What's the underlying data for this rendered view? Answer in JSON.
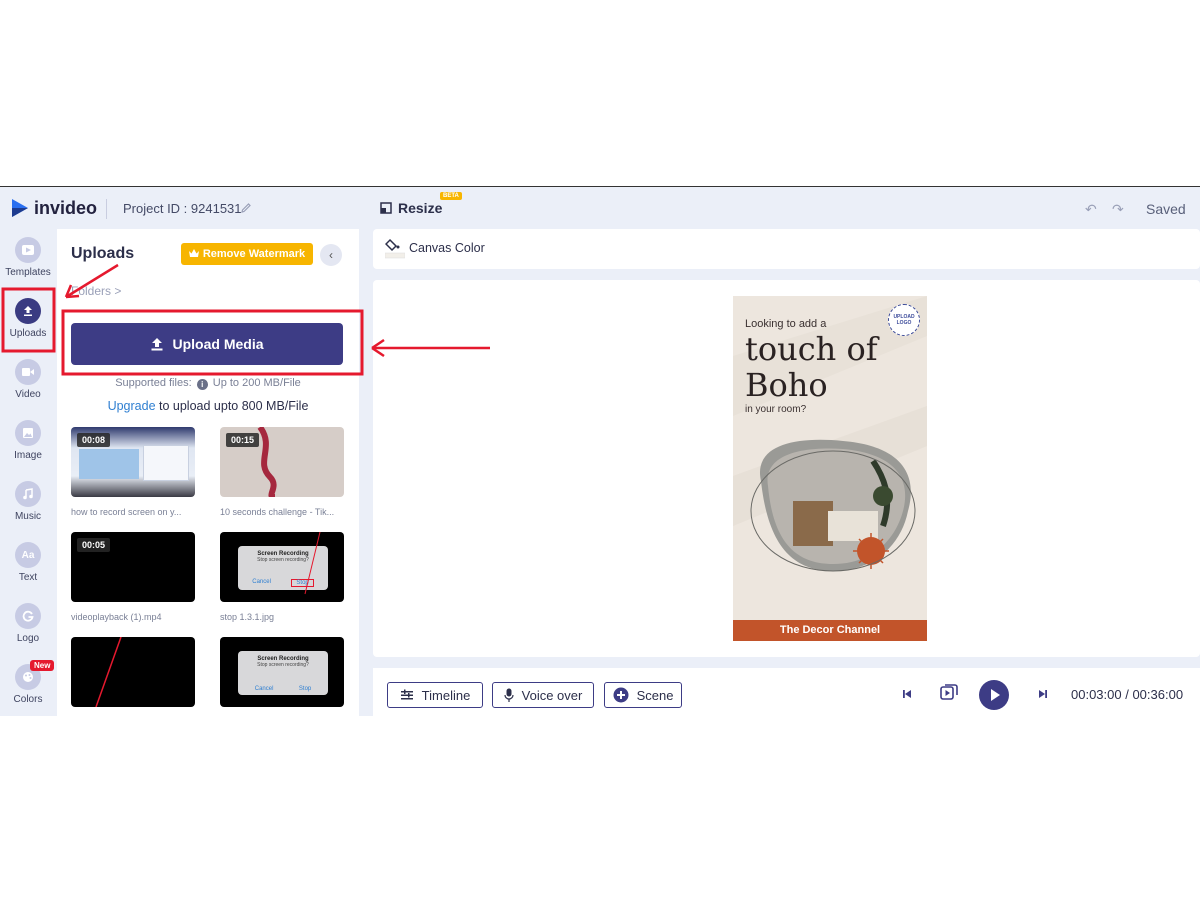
{
  "header": {
    "brand": "invideo",
    "project_id": "Project ID : 9241531",
    "resize_label": "Resize",
    "beta_badge": "BETA",
    "saved_label": "Saved"
  },
  "sidebar": {
    "items": [
      {
        "label": "Templates",
        "icon": "templates-icon"
      },
      {
        "label": "Uploads",
        "icon": "upload-icon"
      },
      {
        "label": "Video",
        "icon": "video-icon"
      },
      {
        "label": "Image",
        "icon": "image-icon"
      },
      {
        "label": "Music",
        "icon": "music-icon"
      },
      {
        "label": "Text",
        "icon": "text-icon"
      },
      {
        "label": "Logo",
        "icon": "logo-icon"
      },
      {
        "label": "Colors",
        "icon": "colors-icon",
        "badge": "New"
      }
    ]
  },
  "panel": {
    "title": "Uploads",
    "remove_watermark": "Remove Watermark",
    "folders": "Folders >",
    "upload_button": "Upload Media",
    "supported_label": "Supported files:",
    "supported_limit": "Up to 200 MB/File",
    "upgrade_link": "Upgrade",
    "upgrade_text": " to upload upto 800 MB/File",
    "media": [
      {
        "duration": "00:08",
        "name": "how to record screen on y..."
      },
      {
        "duration": "00:15",
        "name": "10 seconds challenge - Tik..."
      },
      {
        "duration": "00:05",
        "name": "videoplayback (1).mp4"
      },
      {
        "duration": "",
        "name": "stop 1.3.1.jpg"
      },
      {
        "duration": "",
        "name": ""
      },
      {
        "duration": "",
        "name": ""
      }
    ],
    "dialog": {
      "title": "Screen Recording",
      "subtitle": "Stop screen recording?",
      "cancel": "Cancel",
      "stop": "Stop"
    }
  },
  "canvas": {
    "color_label": "Canvas Color",
    "poster": {
      "line1": "Looking to add a",
      "line2": "touch of",
      "line3": "Boho",
      "line4": "in your room?",
      "logo_text": "UPLOAD LOGO",
      "footer": "The Decor Channel"
    }
  },
  "timeline_bar": {
    "timeline": "Timeline",
    "voice_over": "Voice over",
    "scene": "Scene",
    "time_current": "00:03:00",
    "time_separator": " / ",
    "time_total": "00:36:00"
  },
  "colors": {
    "accent": "#3d3c85",
    "watermark": "#f7b500",
    "annotation": "#e5192e",
    "poster_footer": "#c2542a"
  }
}
